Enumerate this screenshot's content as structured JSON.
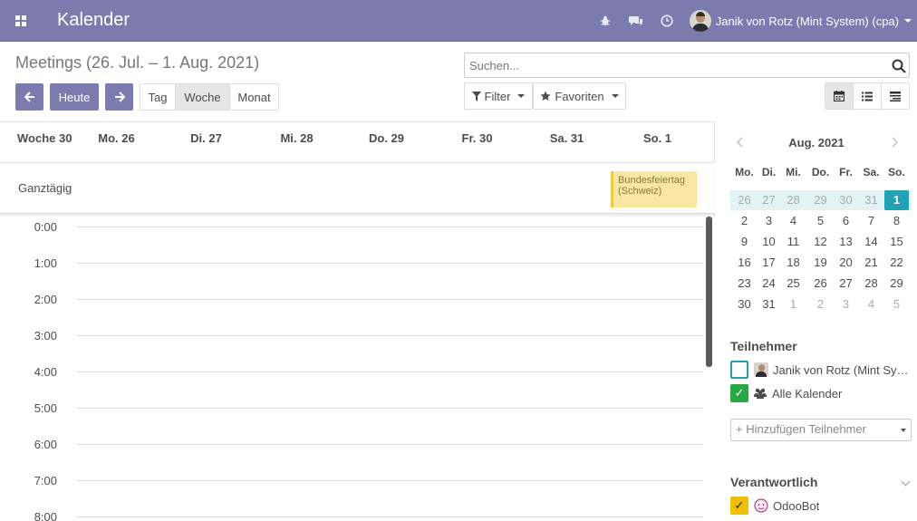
{
  "navbar": {
    "app_title": "Kalender",
    "icons": [
      "apps-icon",
      "bug-icon",
      "chat-icon",
      "clock-icon"
    ],
    "user_name": "Janik von Rotz (Mint System) (cpa)"
  },
  "control_panel": {
    "breadcrumb": "Meetings (26. Jul. – 1. Aug. 2021)",
    "today_label": "Heute",
    "scale_buttons": [
      "Tag",
      "Woche",
      "Monat"
    ],
    "active_scale": "Woche",
    "search_placeholder": "Suchen...",
    "filter_label": "Filter",
    "favorites_label": "Favoriten",
    "views": [
      "calendar-view-icon",
      "list-view-icon",
      "activity-view-icon"
    ],
    "active_view": "calendar-view-icon"
  },
  "calendar": {
    "week_label": "Woche 30",
    "days": [
      "Mo. 26",
      "Di. 27",
      "Mi. 28",
      "Do. 29",
      "Fr. 30",
      "Sa. 31",
      "So. 1"
    ],
    "allday_label": "Ganztägig",
    "allday_event": "Bundesfeiertag (Schweiz)",
    "hours": [
      "0:00",
      "1:00",
      "2:00",
      "3:00",
      "4:00",
      "5:00",
      "6:00",
      "7:00",
      "8:00"
    ]
  },
  "sidebar": {
    "mini_title": "Aug. 2021",
    "weekdays": [
      "Mo.",
      "Di.",
      "Mi.",
      "Do.",
      "Fr.",
      "Sa.",
      "So."
    ],
    "weeks": [
      [
        "26",
        "27",
        "28",
        "29",
        "30",
        "31",
        "1"
      ],
      [
        "2",
        "3",
        "4",
        "5",
        "6",
        "7",
        "8"
      ],
      [
        "9",
        "10",
        "11",
        "12",
        "13",
        "14",
        "15"
      ],
      [
        "16",
        "17",
        "18",
        "19",
        "20",
        "21",
        "22"
      ],
      [
        "23",
        "24",
        "25",
        "26",
        "27",
        "28",
        "29"
      ],
      [
        "30",
        "31",
        "1",
        "2",
        "3",
        "4",
        "5"
      ]
    ],
    "attendees_title": "Teilnehmer",
    "attendee_1": "Janik von Rotz (Mint System) (cpa)",
    "attendee_all": "Alle Kalender",
    "add_attendee_placeholder": "+ Hinzufügen Teilnehmer",
    "responsible_title": "Verantwortlich",
    "responsible_1": "OdooBot"
  },
  "colors": {
    "brand": "#7c7bad",
    "today": "#21a1b3",
    "event_bg": "#f7e7a0"
  }
}
